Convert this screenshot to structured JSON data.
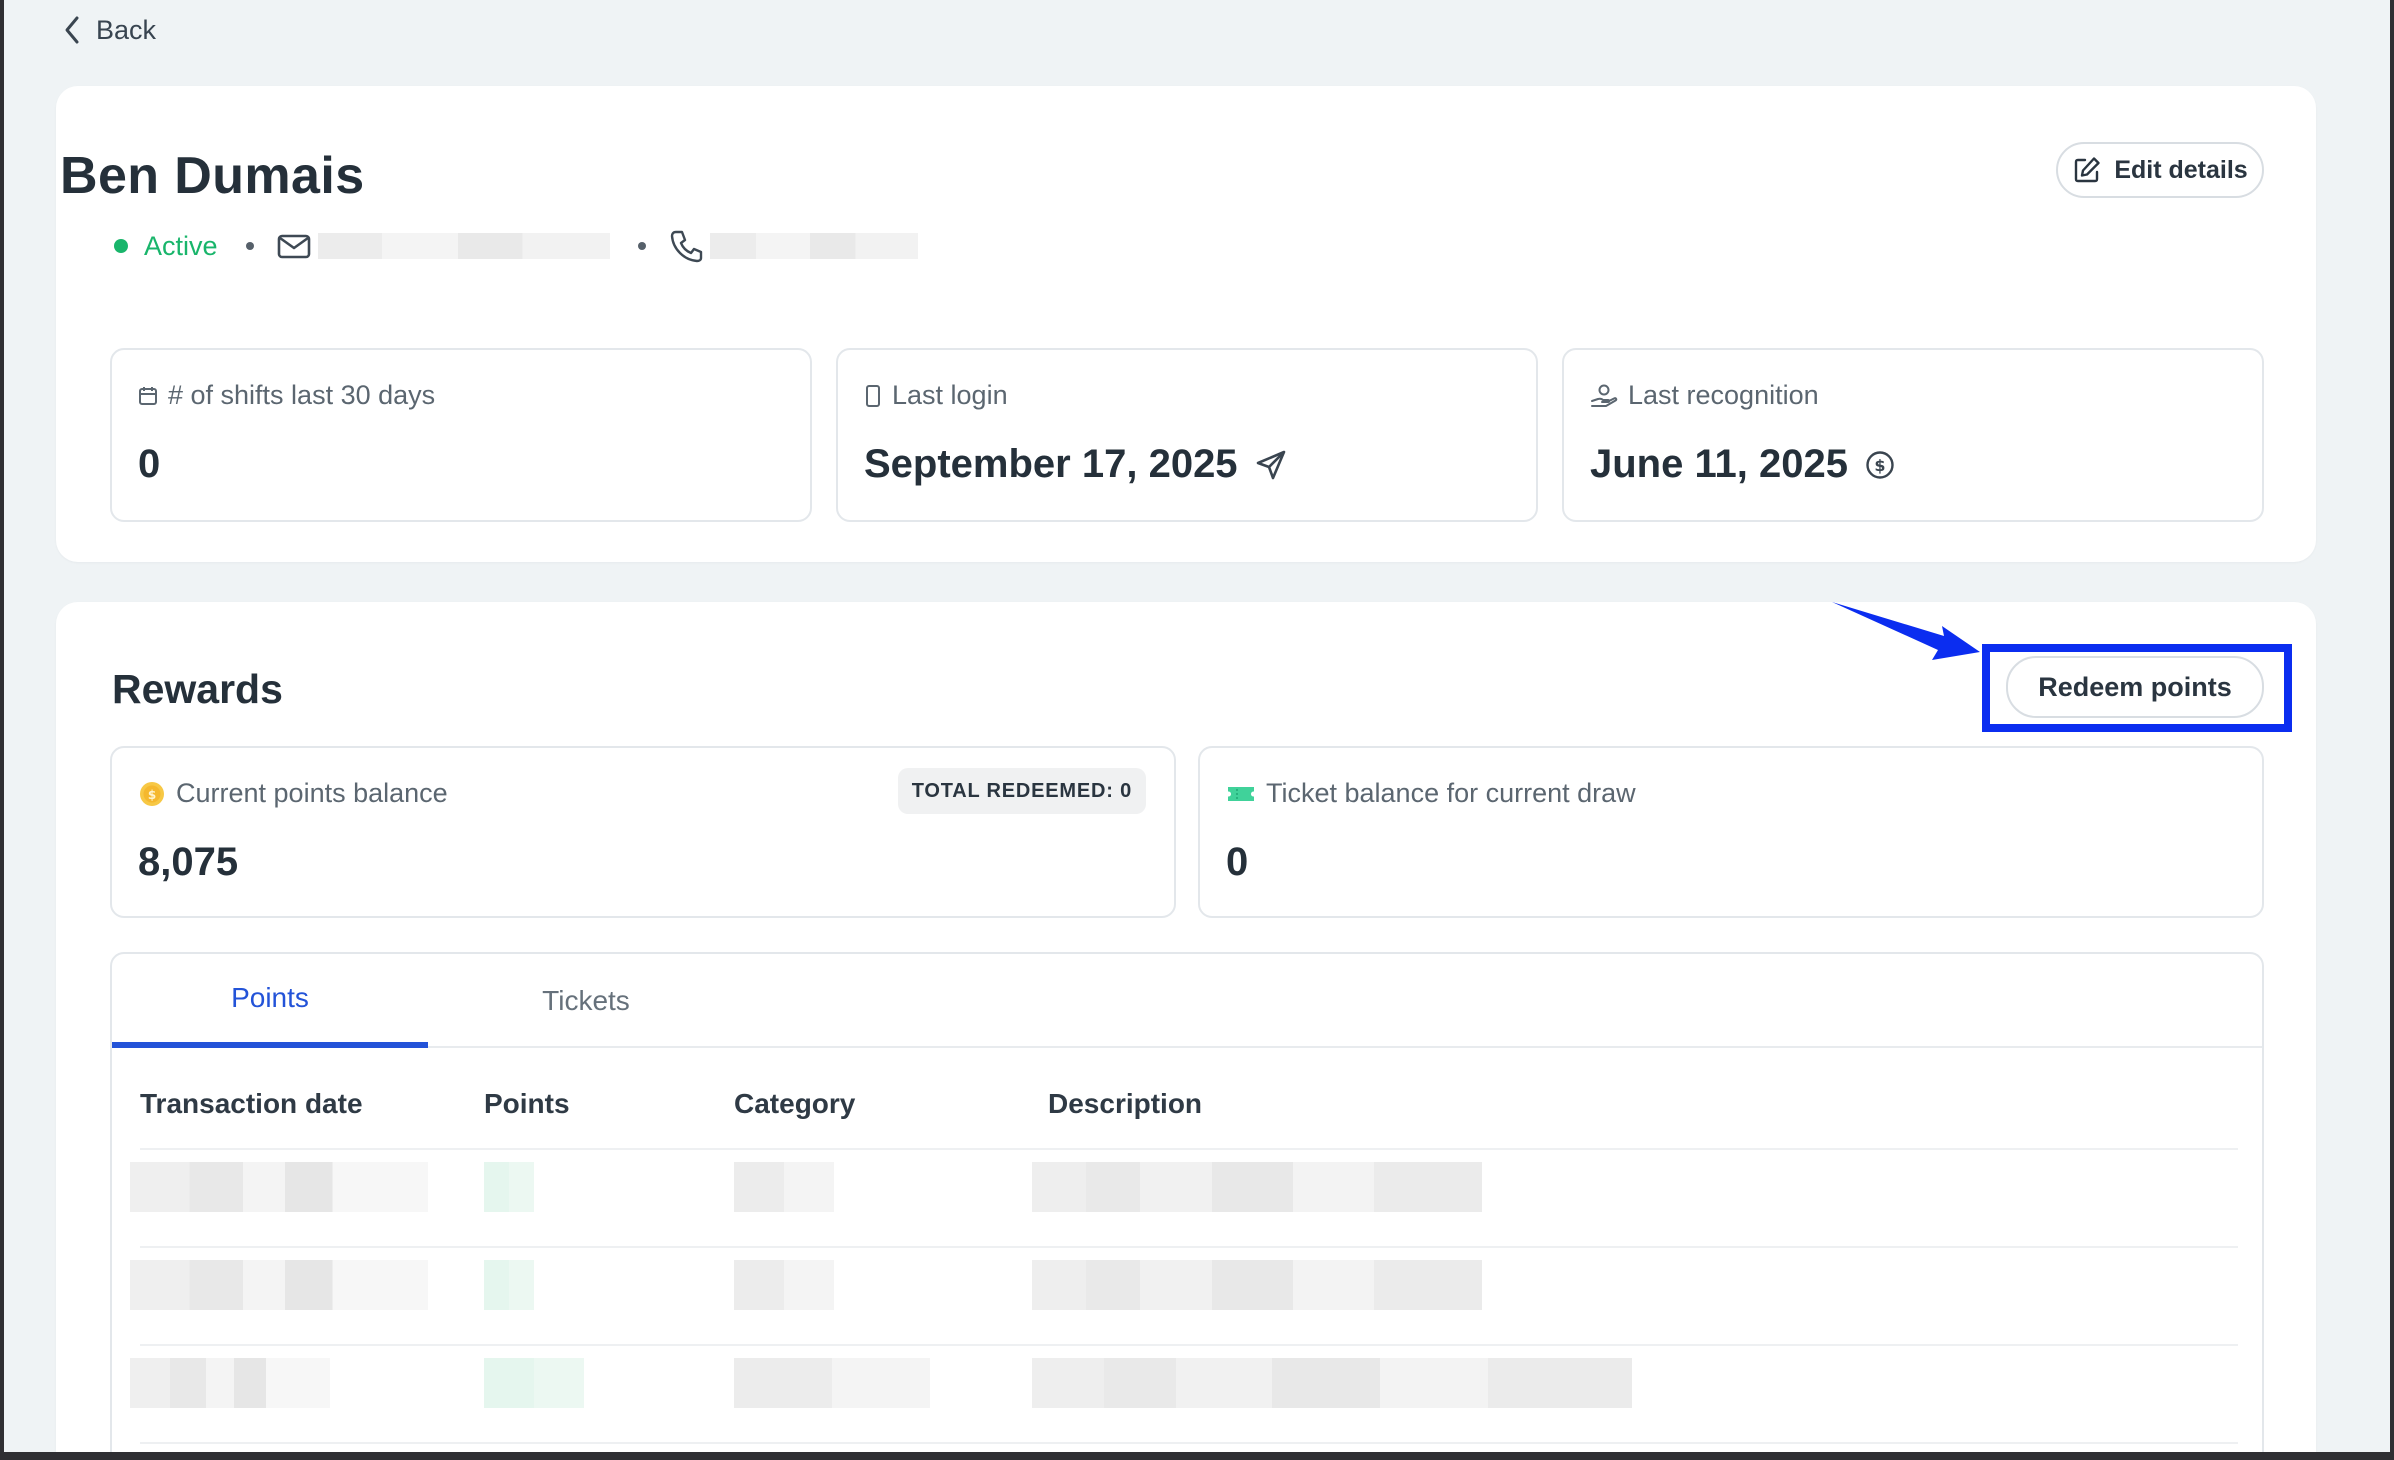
{
  "nav": {
    "back_label": "Back"
  },
  "profile": {
    "name": "Ben Dumais",
    "status": "Active",
    "edit_label": "Edit details"
  },
  "stats": {
    "shifts": {
      "label": "# of shifts last 30 days",
      "value": "0",
      "icon": "calendar-icon"
    },
    "last_login": {
      "label": "Last login",
      "value": "September 17, 2025",
      "icon": "device-icon",
      "value_icon": "send-icon"
    },
    "last_recognition": {
      "label": "Last recognition",
      "value": "June 11, 2025",
      "icon": "hand-coin-icon",
      "value_icon": "dollar-circle-icon"
    }
  },
  "rewards": {
    "title": "Rewards",
    "redeem_label": "Redeem points",
    "points_balance": {
      "label": "Current points balance",
      "value": "8,075",
      "badge": "TOTAL REDEEMED: 0",
      "icon": "coin-icon"
    },
    "ticket_balance": {
      "label": "Ticket balance for current draw",
      "value": "0",
      "icon": "ticket-icon"
    },
    "tabs": [
      {
        "label": "Points",
        "active": true
      },
      {
        "label": "Tickets",
        "active": false
      }
    ],
    "table": {
      "headers": [
        "Transaction date",
        "Points",
        "Category",
        "Description"
      ]
    }
  },
  "colors": {
    "active_status": "#19b56b",
    "tab_active": "#2353d8",
    "annotation": "#0b2df0",
    "page_background": "#eff3f5"
  }
}
